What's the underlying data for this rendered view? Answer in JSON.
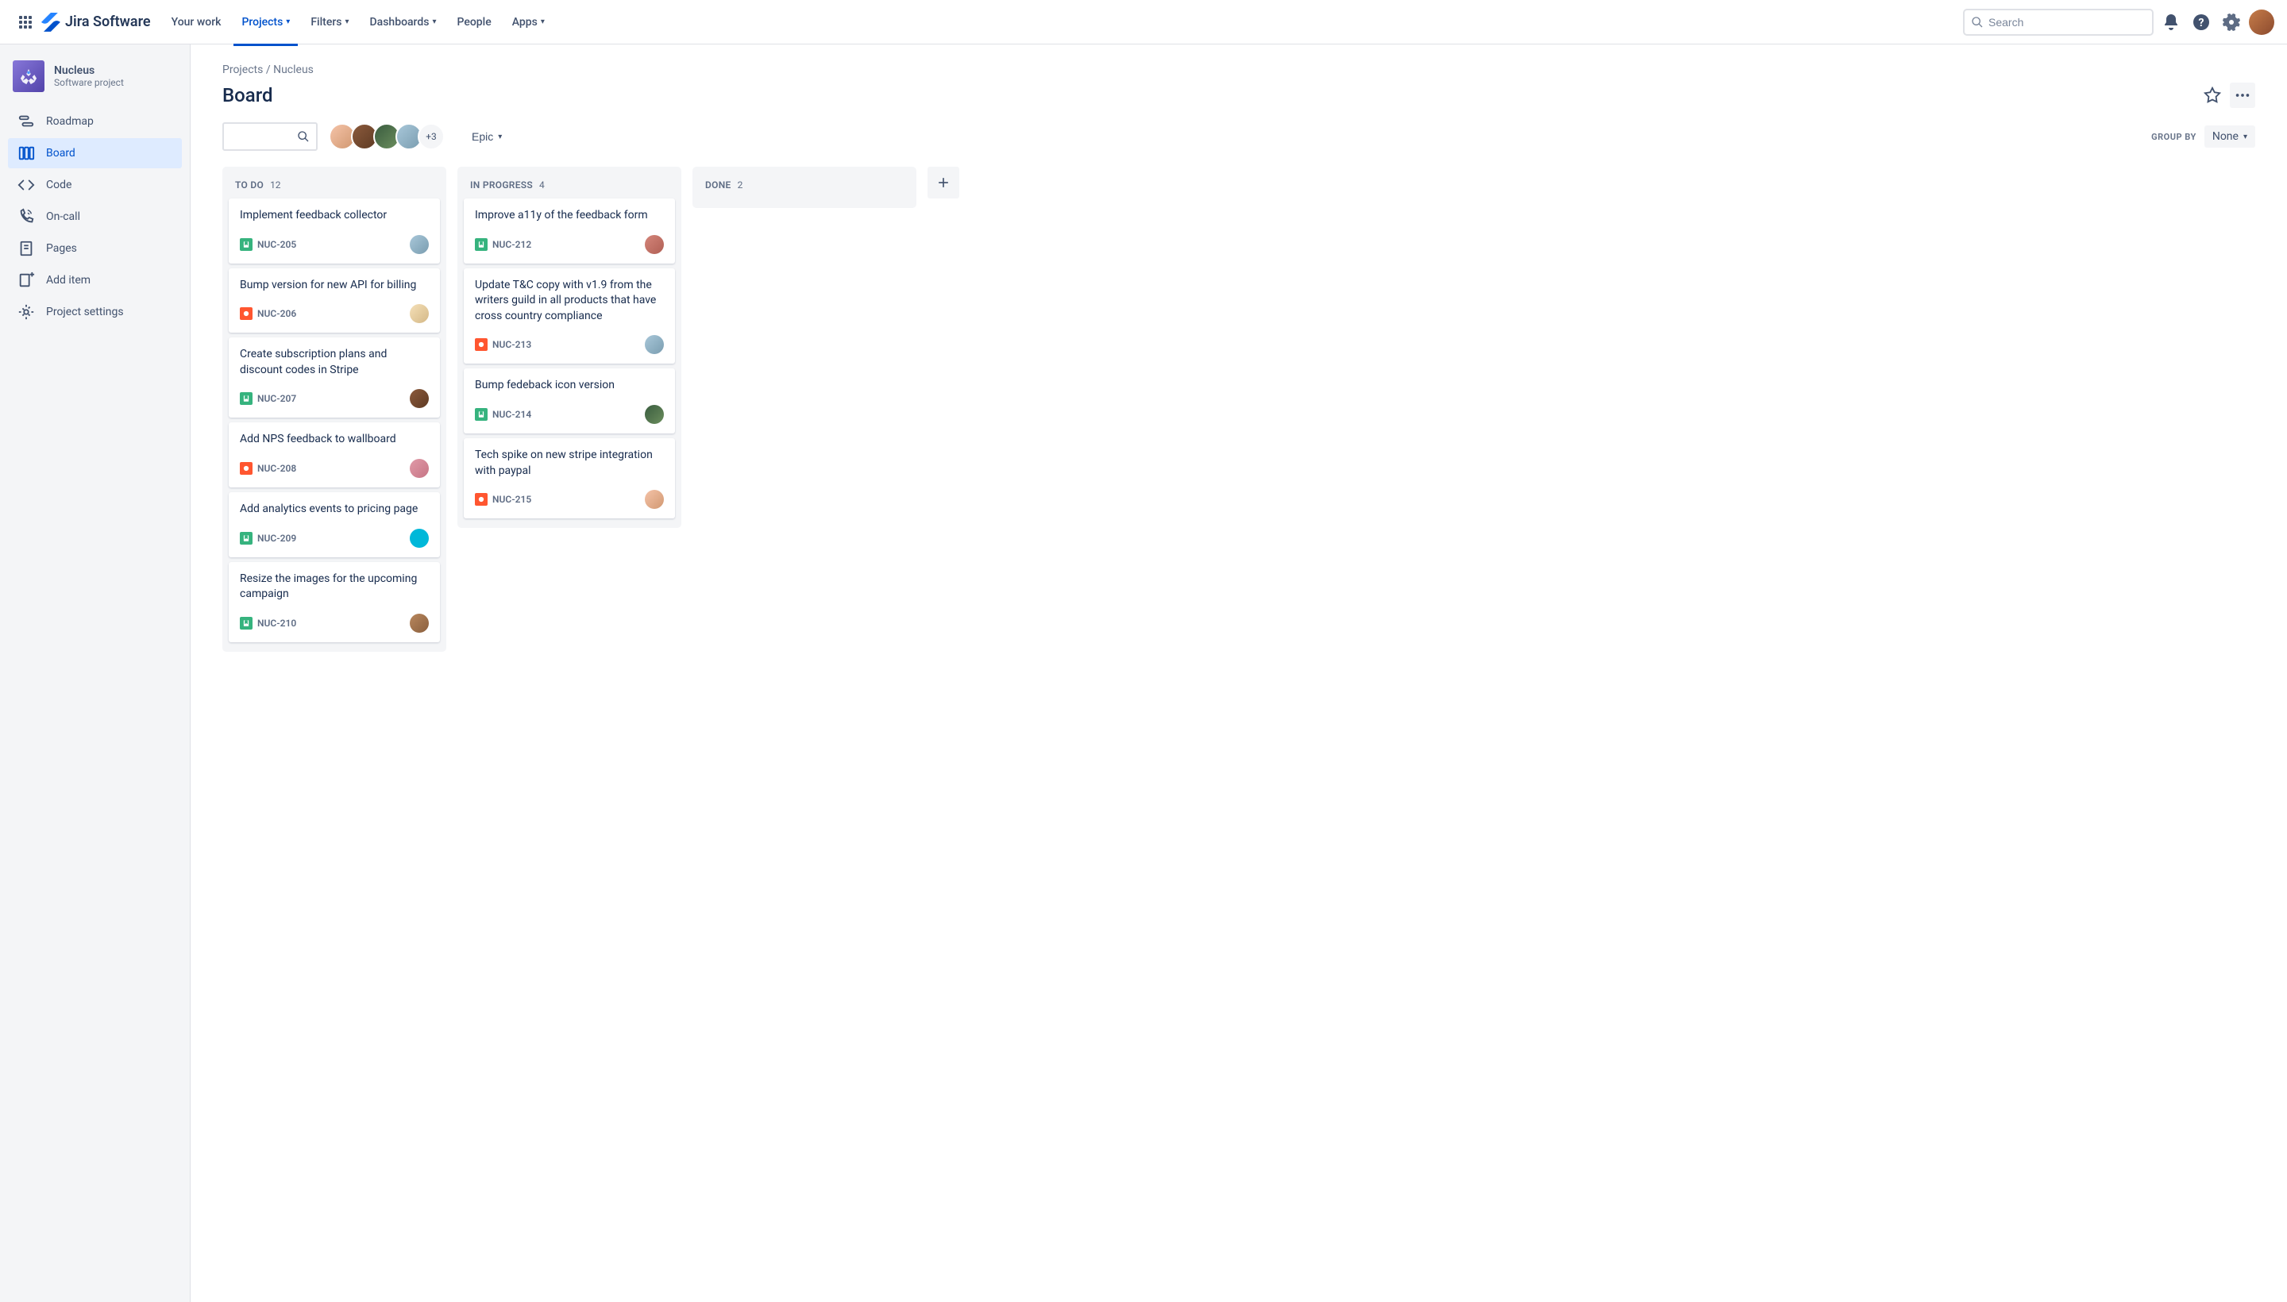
{
  "header": {
    "logo_text": "Jira Software",
    "nav": {
      "your_work": "Your work",
      "projects": "Projects",
      "filters": "Filters",
      "dashboards": "Dashboards",
      "people": "People",
      "apps": "Apps"
    },
    "search_placeholder": "Search"
  },
  "sidebar": {
    "project_name": "Nucleus",
    "project_type": "Software project",
    "items": {
      "roadmap": "Roadmap",
      "board": "Board",
      "code": "Code",
      "on_call": "On-call",
      "pages": "Pages",
      "add_item": "Add item",
      "project_settings": "Project settings"
    }
  },
  "breadcrumb": {
    "projects": "Projects",
    "current": "Nucleus"
  },
  "page": {
    "title": "Board"
  },
  "controls": {
    "avatar_more": "+3",
    "epic_label": "Epic",
    "group_by_label": "GROUP BY",
    "group_by_value": "None"
  },
  "columns": [
    {
      "title": "TO DO",
      "count": "12",
      "cards": [
        {
          "title": "Implement feedback collector",
          "type": "story",
          "key": "NUC-205",
          "avatar": "cav1"
        },
        {
          "title": "Bump version for new API for billing",
          "type": "bug",
          "key": "NUC-206",
          "avatar": "cav2"
        },
        {
          "title": "Create subscription plans and discount codes in Stripe",
          "type": "story",
          "key": "NUC-207",
          "avatar": "cav3"
        },
        {
          "title": "Add NPS feedback to wallboard",
          "type": "bug",
          "key": "NUC-208",
          "avatar": "cav4"
        },
        {
          "title": "Add analytics events to pricing page",
          "type": "story",
          "key": "NUC-209",
          "avatar": "cav5"
        },
        {
          "title": "Resize the images for the upcoming campaign",
          "type": "story",
          "key": "NUC-210",
          "avatar": "cav6"
        }
      ]
    },
    {
      "title": "IN PROGRESS",
      "count": "4",
      "cards": [
        {
          "title": "Improve a11y of the feedback form",
          "type": "story",
          "key": "NUC-212",
          "avatar": "cav7"
        },
        {
          "title": "Update T&C copy with v1.9 from the writers guild in all products that have cross country compliance",
          "type": "bug",
          "key": "NUC-213",
          "avatar": "cav1"
        },
        {
          "title": "Bump fedeback icon version",
          "type": "story",
          "key": "NUC-214",
          "avatar": "cav9"
        },
        {
          "title": "Tech spike on new stripe integration with paypal",
          "type": "bug",
          "key": "NUC-215",
          "avatar": "cav8"
        }
      ]
    },
    {
      "title": "DONE",
      "count": "2",
      "cards": []
    }
  ]
}
